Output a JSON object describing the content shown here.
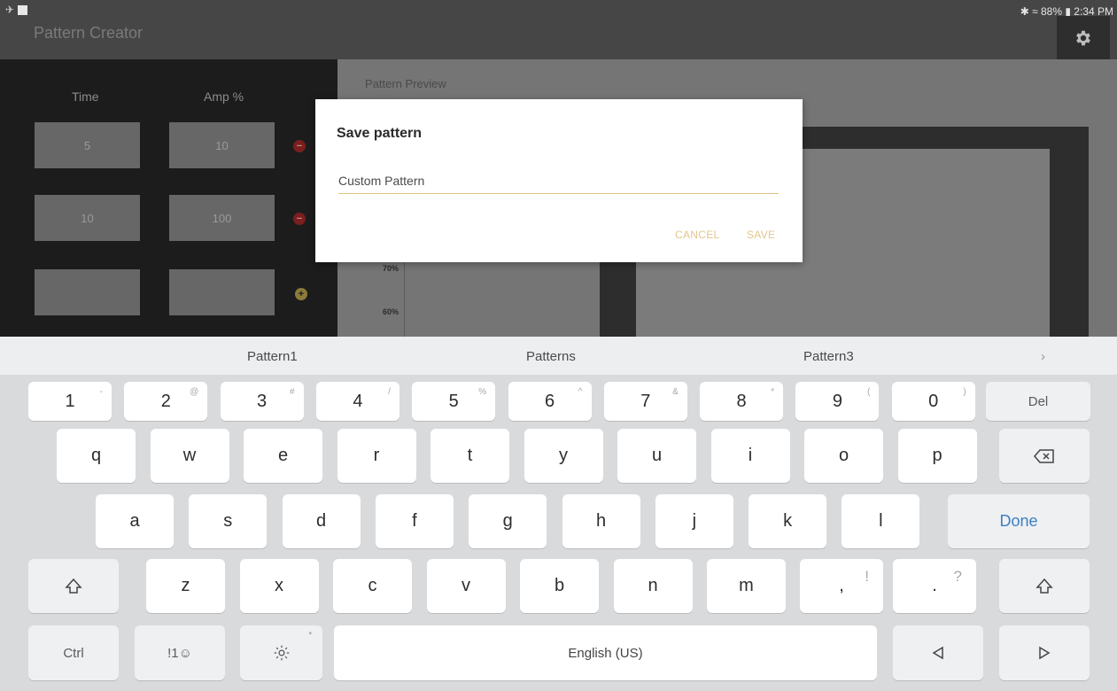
{
  "status_bar": {
    "right_text": "✱ ≈ 88% ▮ 2:34 PM"
  },
  "app": {
    "title": "Pattern Creator"
  },
  "editor": {
    "time_header": "Time",
    "amp_header": "Amp %",
    "rows": [
      {
        "time": "5",
        "amp": "10",
        "action": "remove"
      },
      {
        "time": "10",
        "amp": "100",
        "action": "remove"
      },
      {
        "time": "",
        "amp": "",
        "action": "add"
      }
    ]
  },
  "preview": {
    "title": "Pattern Preview",
    "y_ticks": [
      "70%",
      "60%"
    ]
  },
  "dialog": {
    "title": "Save pattern",
    "input_value": "Custom Pattern",
    "cancel_label": "CANCEL",
    "save_label": "SAVE"
  },
  "keyboard": {
    "suggestions": [
      "Pattern1",
      "Patterns",
      "Pattern3"
    ],
    "suggest_more": "›",
    "number_row": [
      {
        "main": "1",
        "sup": "-"
      },
      {
        "main": "2",
        "sup": "@"
      },
      {
        "main": "3",
        "sup": "#"
      },
      {
        "main": "4",
        "sup": "/"
      },
      {
        "main": "5",
        "sup": "%"
      },
      {
        "main": "6",
        "sup": "^"
      },
      {
        "main": "7",
        "sup": "&"
      },
      {
        "main": "8",
        "sup": "*"
      },
      {
        "main": "9",
        "sup": "("
      },
      {
        "main": "0",
        "sup": ")"
      }
    ],
    "del_label": "Del",
    "row_q": [
      "q",
      "w",
      "e",
      "r",
      "t",
      "y",
      "u",
      "i",
      "o",
      "p"
    ],
    "row_a": [
      "a",
      "s",
      "d",
      "f",
      "g",
      "h",
      "j",
      "k",
      "l"
    ],
    "done_label": "Done",
    "row_z": [
      "z",
      "x",
      "c",
      "v",
      "b",
      "n",
      "m"
    ],
    "comma": ",",
    "comma_sup": "!",
    "period": ".",
    "period_sup": "?",
    "ctrl_label": "Ctrl",
    "symbols_label": "!1☺",
    "space_label": "English (US)"
  }
}
